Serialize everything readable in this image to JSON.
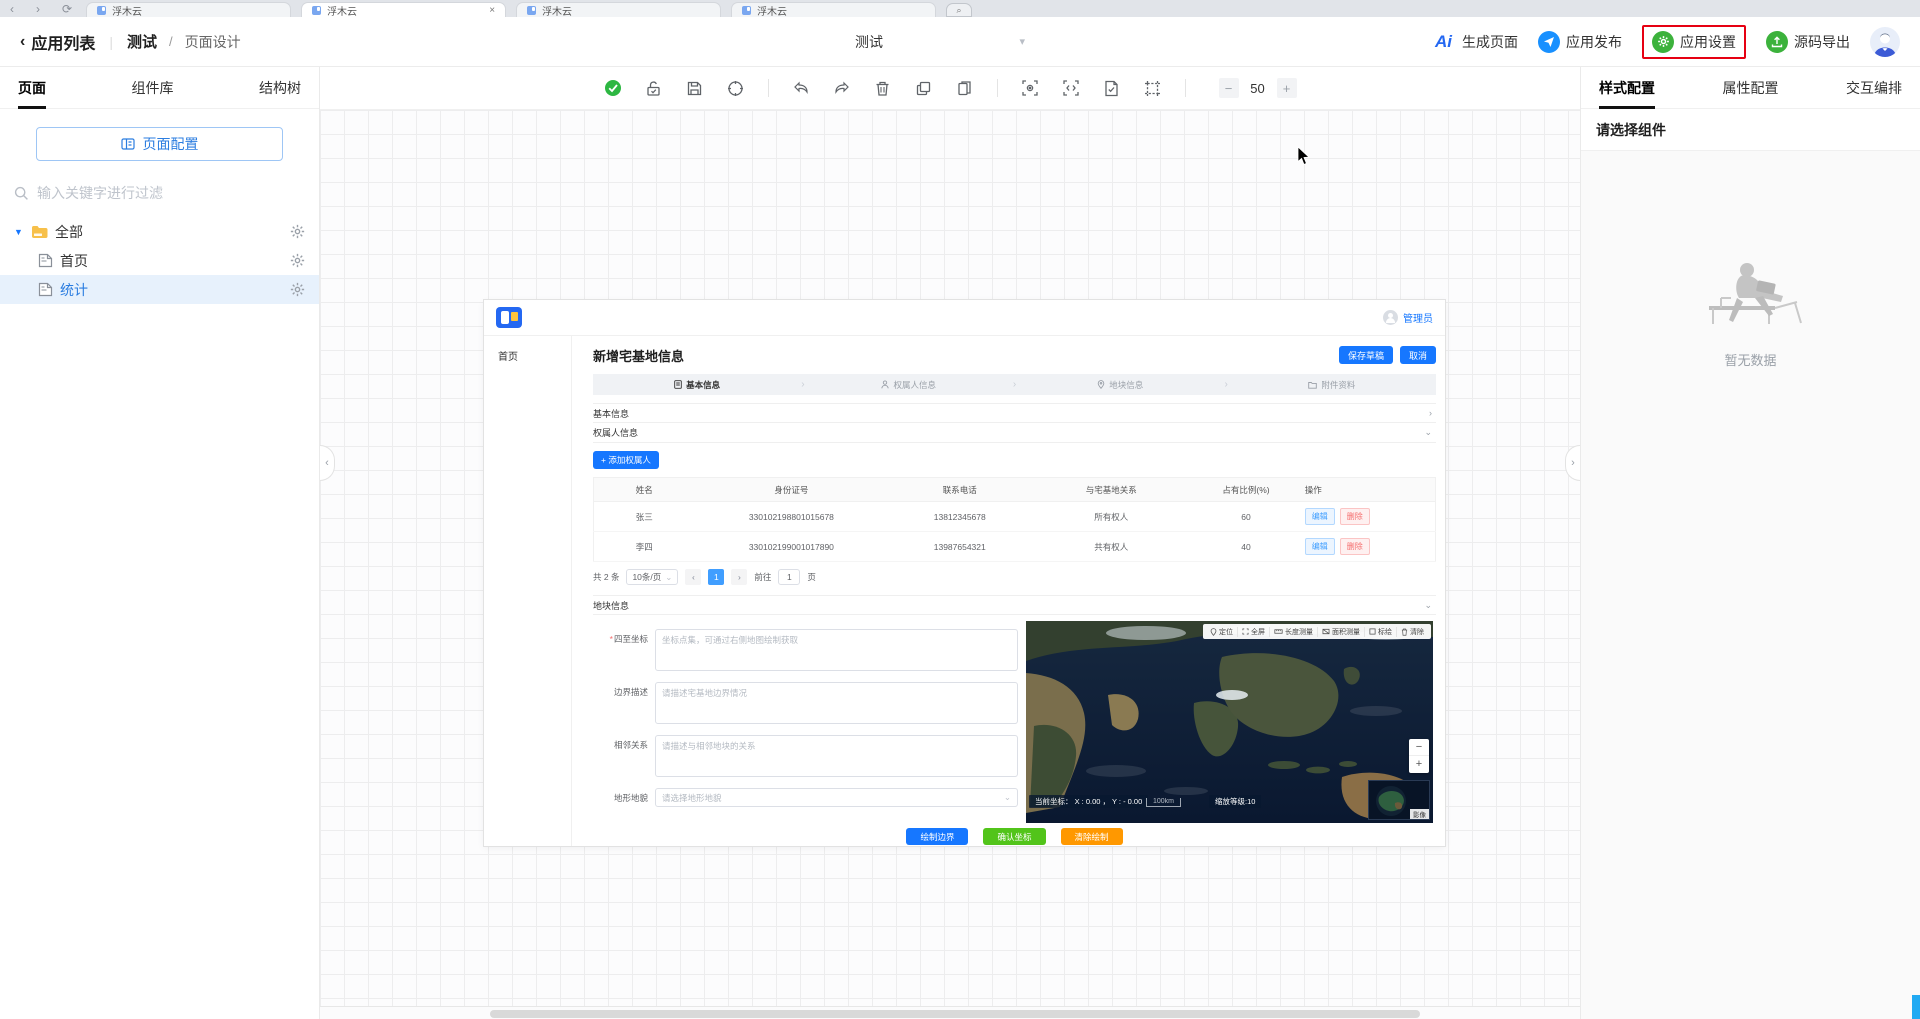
{
  "colors": {
    "accent": "#1677ff",
    "green_action": "#3cb23c",
    "highlight_red": "#e60012",
    "selected_row_bg": "#e7f1fc",
    "canvas_grid": "#ededee"
  },
  "browser": {
    "tabs": [
      {
        "title": "浮木云"
      },
      {
        "title": "浮木云",
        "active": true,
        "close": "×"
      },
      {
        "title": "浮木云"
      },
      {
        "title": "浮木云"
      }
    ],
    "nav_icons": [
      "back-icon",
      "forward-icon",
      "refresh-icon"
    ],
    "search_icon": "magnifier"
  },
  "header": {
    "back_label": "应用列表",
    "breadcrumb_app": "测试",
    "breadcrumb_sep": "/",
    "breadcrumb_page": "页面设计",
    "page_select_value": "测试",
    "actions": {
      "generate": {
        "label": "生成页面",
        "icon": "ai-logo",
        "logo_text": "Ai"
      },
      "publish": {
        "label": "应用发布",
        "icon": "send-icon"
      },
      "settings": {
        "label": "应用设置",
        "icon": "gear-icon",
        "highlighted": true
      },
      "export": {
        "label": "源码导出",
        "icon": "export-icon"
      }
    }
  },
  "left_panel": {
    "tabs": [
      {
        "label": "页面",
        "active": true
      },
      {
        "label": "组件库"
      },
      {
        "label": "结构树"
      }
    ],
    "config_button": "页面配置",
    "search_placeholder": "输入关键字进行过滤",
    "tree": [
      {
        "label": "全部",
        "type": "folder",
        "expanded": true
      },
      {
        "label": "首页",
        "type": "page"
      },
      {
        "label": "统计",
        "type": "page",
        "selected": true
      }
    ]
  },
  "toolbar": {
    "icons": [
      "status-check",
      "unlock",
      "save",
      "focus-target",
      "undo",
      "redo",
      "delete",
      "copy",
      "paste",
      "preview-scan",
      "code-view",
      "page-check",
      "frame-select"
    ],
    "zoom_minus": "−",
    "zoom_value": "50",
    "zoom_plus": "+"
  },
  "right_panel": {
    "tabs": [
      {
        "label": "样式配置",
        "active": true
      },
      {
        "label": "属性配置"
      },
      {
        "label": "交互编排"
      }
    ],
    "hint": "请选择组件",
    "empty_text": "暂无数据"
  },
  "preview": {
    "admin_label": "管理员",
    "nav_home": "首页",
    "title": "新增宅基地信息",
    "save_draft": "保存草稿",
    "cancel": "取消",
    "steps": [
      {
        "label": "基本信息",
        "icon": "doc-icon",
        "active": true
      },
      {
        "label": "权属人信息",
        "icon": "person-icon"
      },
      {
        "label": "地块信息",
        "icon": "pin-icon"
      },
      {
        "label": "附件资料",
        "icon": "folder-icon"
      }
    ],
    "sections": {
      "basic": "基本信息",
      "owner": "权属人信息",
      "land": "地块信息"
    },
    "add_owner_button": "+ 添加权属人",
    "table": {
      "columns": [
        "姓名",
        "身份证号",
        "联系电话",
        "与宅基地关系",
        "占有比例(%)",
        "操作"
      ],
      "rows": [
        {
          "name": "张三",
          "id": "330102198801015678",
          "phone": "13812345678",
          "relation": "所有权人",
          "ratio": "60"
        },
        {
          "name": "李四",
          "id": "330102199001017890",
          "phone": "13987654321",
          "relation": "共有权人",
          "ratio": "40"
        }
      ],
      "edit_label": "编辑",
      "delete_label": "删除"
    },
    "pagination": {
      "total": "共 2 条",
      "page_size": "10条/页",
      "prev": "‹",
      "current": "1",
      "next": "›",
      "goto_prefix": "前往",
      "goto_value": "1",
      "goto_suffix": "页"
    },
    "form": {
      "fields": [
        {
          "label": "四至坐标",
          "required": true,
          "placeholder": "坐标点集，可通过右侧地图绘制获取"
        },
        {
          "label": "边界描述",
          "placeholder": "请描述宅基地边界情况"
        },
        {
          "label": "相邻关系",
          "placeholder": "请描述与相邻地块的关系"
        },
        {
          "label": "地形地貌",
          "placeholder": "请选择地形地貌"
        }
      ]
    },
    "map": {
      "toolbar": [
        "定位",
        "全屏",
        "长度测量",
        "面积测量",
        "标绘",
        "清除"
      ],
      "coord_text": "当前坐标：  X : 0.00 ， Y : - 0.00",
      "scale_text": "100km",
      "zoom_level_text": "缩放等级:10",
      "zoom_out": "−",
      "zoom_in": "+",
      "layer_label": "影像"
    },
    "bottom_buttons": [
      {
        "label": "绘制边界",
        "color": "blue"
      },
      {
        "label": "确认坐标",
        "color": "green"
      },
      {
        "label": "清除绘制",
        "color": "orange"
      }
    ]
  }
}
